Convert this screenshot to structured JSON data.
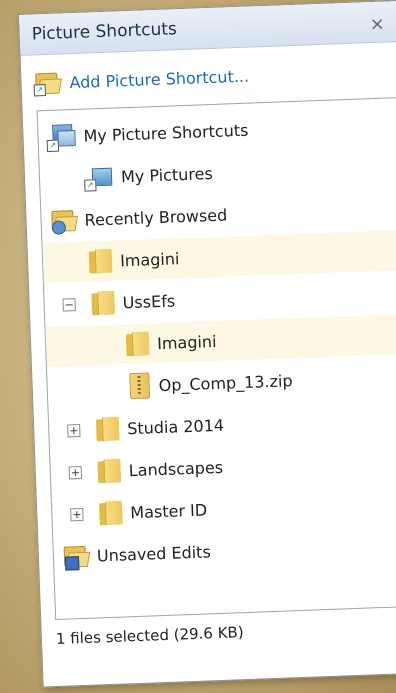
{
  "panel": {
    "title": "Picture Shortcuts",
    "close_glyph": "×",
    "add_label": "Add Picture Shortcut..."
  },
  "tree": {
    "items": [
      {
        "label": "My Picture Shortcuts",
        "icon": "pictures-shortcut-icon"
      },
      {
        "label": "My Pictures",
        "icon": "pictures-folder-icon"
      },
      {
        "label": "Recently Browsed",
        "icon": "recent-folder-icon"
      },
      {
        "label": "Imagini",
        "icon": "folder-icon",
        "selected": true
      },
      {
        "label": "UssEfs",
        "icon": "folder-icon",
        "expander": "collapse"
      },
      {
        "label": "Imagini",
        "icon": "folder-icon",
        "selected": true
      },
      {
        "label": "Op_Comp_13.zip",
        "icon": "zip-file-icon"
      },
      {
        "label": "Studia 2014",
        "icon": "folder-icon",
        "expander": "expand"
      },
      {
        "label": "Landscapes",
        "icon": "folder-icon",
        "expander": "expand"
      },
      {
        "label": "Master ID",
        "icon": "folder-icon",
        "expander": "expand"
      },
      {
        "label": "Unsaved Edits",
        "icon": "unsaved-edits-folder-icon"
      }
    ]
  },
  "status": {
    "text": "1 files selected (29.6 KB)"
  }
}
